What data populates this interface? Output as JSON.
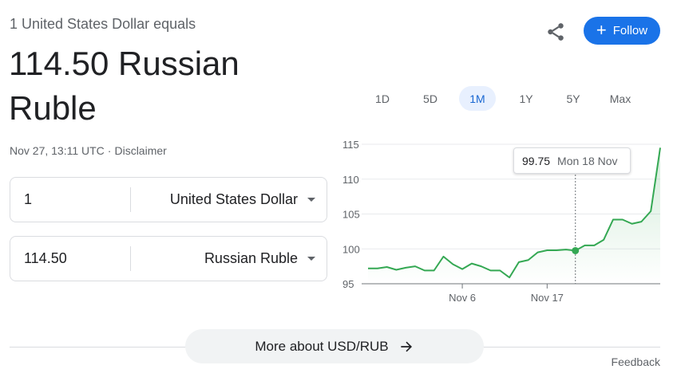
{
  "header": {
    "subtitle": "1 United States Dollar equals",
    "headline": "114.50 Russian Ruble",
    "timestamp": "Nov 27, 13:11 UTC",
    "separator": "·",
    "disclaimer": "Disclaimer"
  },
  "actions": {
    "share_icon": "share-icon",
    "follow_label": "Follow",
    "follow_icon": "+"
  },
  "converter": {
    "from": {
      "value": "1",
      "currency": "United States Dollar"
    },
    "to": {
      "value": "114.50",
      "currency": "Russian Ruble"
    }
  },
  "range_tabs": {
    "items": [
      "1D",
      "5D",
      "1M",
      "1Y",
      "5Y",
      "Max"
    ],
    "active": "1M"
  },
  "tooltip": {
    "value": "99.75",
    "date": "Mon 18 Nov"
  },
  "colors": {
    "accent": "#1a73e8",
    "line": "#34a853",
    "grid": "#e8eaed"
  },
  "chart_data": {
    "type": "line",
    "x_label_ticks": [
      {
        "index": 10,
        "label": "Nov 6"
      },
      {
        "index": 19,
        "label": "Nov 17"
      }
    ],
    "y_ticks": [
      95,
      100,
      105,
      110,
      115
    ],
    "ylim": [
      95,
      115
    ],
    "values": [
      97.2,
      97.2,
      97.4,
      97.0,
      97.3,
      97.5,
      96.9,
      96.9,
      98.9,
      97.8,
      97.1,
      97.9,
      97.5,
      96.9,
      96.9,
      95.9,
      98.1,
      98.4,
      99.5,
      99.8,
      99.8,
      99.9,
      99.75,
      100.5,
      100.5,
      101.3,
      104.2,
      104.2,
      103.6,
      103.9,
      105.4,
      114.5
    ],
    "highlight_index": 22,
    "grid": true
  },
  "footer": {
    "more_label": "More about USD/RUB",
    "feedback": "Feedback"
  }
}
